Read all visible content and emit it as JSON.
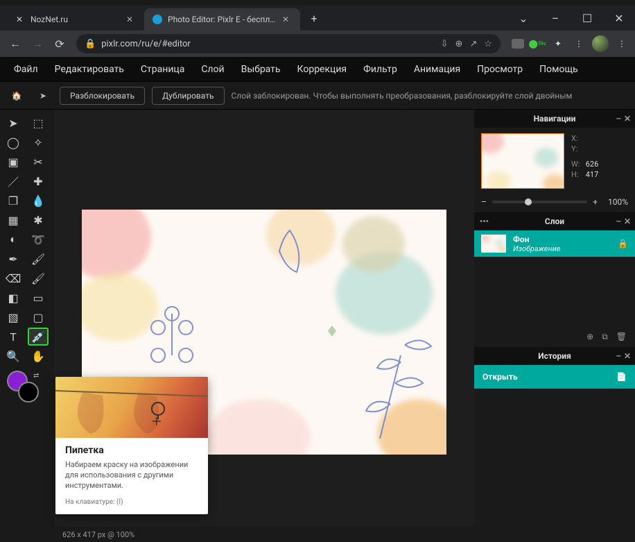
{
  "browser": {
    "tabs": [
      {
        "title": "NozNet.ru",
        "favicon": "wrench"
      },
      {
        "title": "Photo Editor: Pixlr E - бесплатны",
        "favicon": "pixlr"
      }
    ],
    "url": "pixlr.com/ru/e/#editor",
    "windowControls": {
      "min": "–",
      "max": "☐",
      "close": "✕"
    }
  },
  "menubar": [
    "Файл",
    "Редактировать",
    "Страница",
    "Слой",
    "Выбрать",
    "Коррекция",
    "Фильтр",
    "Анимация",
    "Просмотр",
    "Помощь"
  ],
  "toolbar2": {
    "buttons": [
      "Разблокировать",
      "Дублировать"
    ],
    "message": "Слой заблокирован. Чтобы выполнять преобразования, разблокируйте слой двойным"
  },
  "tools": {
    "cells": [
      "arrow",
      "marquee",
      "lasso",
      "wand",
      "crop",
      "scissors",
      "knife",
      "heal",
      "clone",
      "blur-drop",
      "pixelate",
      "disperse",
      "sponge",
      "spiral",
      "pen",
      "brush",
      "eraser",
      "paint",
      "gradient",
      "fill",
      "shape",
      "frame",
      "text",
      "eyedropper",
      "zoom",
      "hand"
    ],
    "selectedIndex": 23
  },
  "tooltip": {
    "title": "Пипетка",
    "desc": "Набираем краску на изображении для использования с другими инструментами.",
    "kbd": "На клавиатуре: (I)"
  },
  "status": "626 x 417 px @ 100%",
  "nav_panel": {
    "title": "Навигации",
    "x_label": "X:",
    "y_label": "Y:",
    "w_label": "W:",
    "h_label": "H:",
    "w": "626",
    "h": "417",
    "zoom": "100%"
  },
  "layers_panel": {
    "title": "Слои",
    "layer_name": "Фон",
    "layer_sub": "Изображение"
  },
  "history_panel": {
    "title": "История",
    "item": "Открыть"
  }
}
